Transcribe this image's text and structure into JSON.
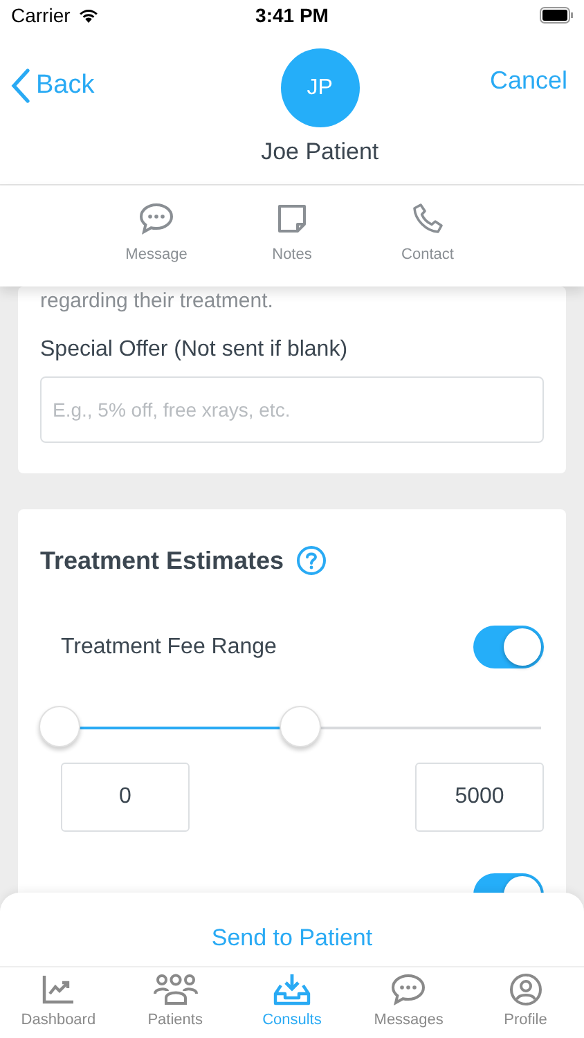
{
  "status_bar": {
    "carrier": "Carrier",
    "time": "3:41 PM"
  },
  "header": {
    "back": "Back",
    "cancel": "Cancel",
    "initials": "JP",
    "name": "Joe Patient"
  },
  "actions": [
    {
      "label": "Message",
      "kind": "message"
    },
    {
      "label": "Notes",
      "kind": "notes"
    },
    {
      "label": "Contact",
      "kind": "contact"
    }
  ],
  "offer_card": {
    "cut_text": "regarding their treatment.",
    "label": "Special Offer (Not sent if blank)",
    "placeholder": "E.g., 5% off, free xrays, etc."
  },
  "estimates_card": {
    "title": "Treatment Estimates",
    "fee_range": {
      "label": "Treatment Fee Range",
      "on": true,
      "thumbs": [
        {
          "level": 0
        },
        {
          "level": 0.5
        }
      ],
      "min": "0",
      "max": "5000"
    },
    "next_toggle": {
      "on": true
    }
  },
  "send_button": "Send to Patient",
  "tab_bar": [
    {
      "label": "Dashboard",
      "kind": "chart",
      "selected": false
    },
    {
      "label": "Patients",
      "kind": "people",
      "selected": false
    },
    {
      "label": "Consults",
      "kind": "inbox",
      "selected": true
    },
    {
      "label": "Messages",
      "kind": "message",
      "selected": false
    },
    {
      "label": "Profile",
      "kind": "profile",
      "selected": false
    }
  ]
}
